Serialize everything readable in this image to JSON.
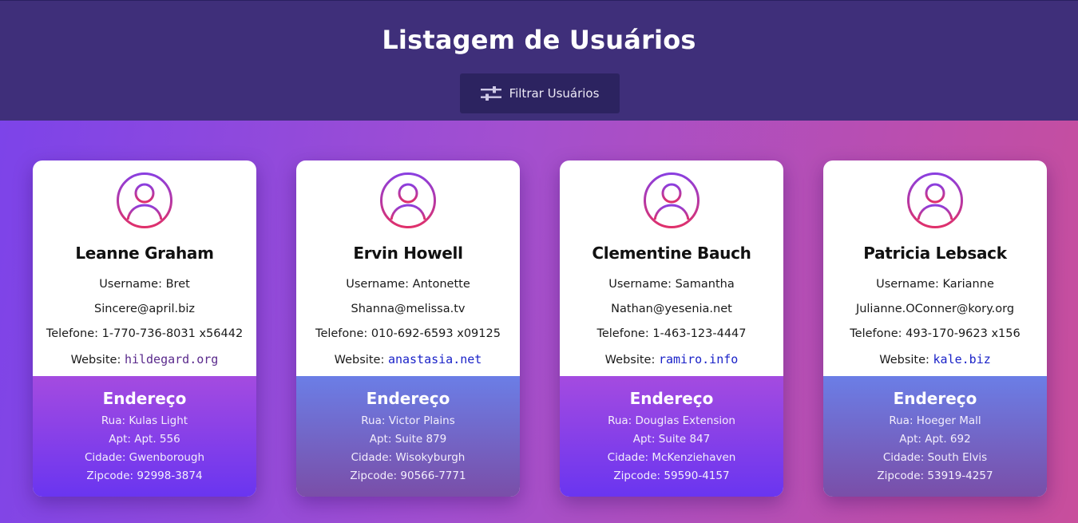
{
  "header": {
    "title": "Listagem de Usuários",
    "filter_button_label": "Filtrar Usuários",
    "filter_icon": "sliders-icon"
  },
  "labels": {
    "username": "Username: ",
    "phone": "Telefone: ",
    "website": "Website: ",
    "address_title": "Endereço",
    "street": "Rua: ",
    "apt": "Apt: ",
    "city": "Cidade: ",
    "zipcode": "Zipcode: "
  },
  "colors": {
    "header_bg": "#3f2f7a",
    "button_bg": "#2c2360",
    "avatar_gradient_start": "#8a3fe0",
    "avatar_gradient_end": "#e0306a"
  },
  "users": [
    {
      "name": "Leanne Graham",
      "username": "Bret",
      "email": "Sincere@april.biz",
      "phone": "1-770-736-8031 x56442",
      "website": "hildegard.org",
      "address": {
        "street": "Kulas Light",
        "apt": "Apt. 556",
        "city": "Gwenborough",
        "zipcode": "92998-3874"
      }
    },
    {
      "name": "Ervin Howell",
      "username": "Antonette",
      "email": "Shanna@melissa.tv",
      "phone": "010-692-6593 x09125",
      "website": "anastasia.net",
      "address": {
        "street": "Victor Plains",
        "apt": "Suite 879",
        "city": "Wisokyburgh",
        "zipcode": "90566-7771"
      }
    },
    {
      "name": "Clementine Bauch",
      "username": "Samantha",
      "email": "Nathan@yesenia.net",
      "phone": "1-463-123-4447",
      "website": "ramiro.info",
      "address": {
        "street": "Douglas Extension",
        "apt": "Suite 847",
        "city": "McKenziehaven",
        "zipcode": "59590-4157"
      }
    },
    {
      "name": "Patricia Lebsack",
      "username": "Karianne",
      "email": "Julianne.OConner@kory.org",
      "phone": "493-170-9623 x156",
      "website": "kale.biz",
      "address": {
        "street": "Hoeger Mall",
        "apt": "Apt. 692",
        "city": "South Elvis",
        "zipcode": "53919-4257"
      }
    }
  ]
}
